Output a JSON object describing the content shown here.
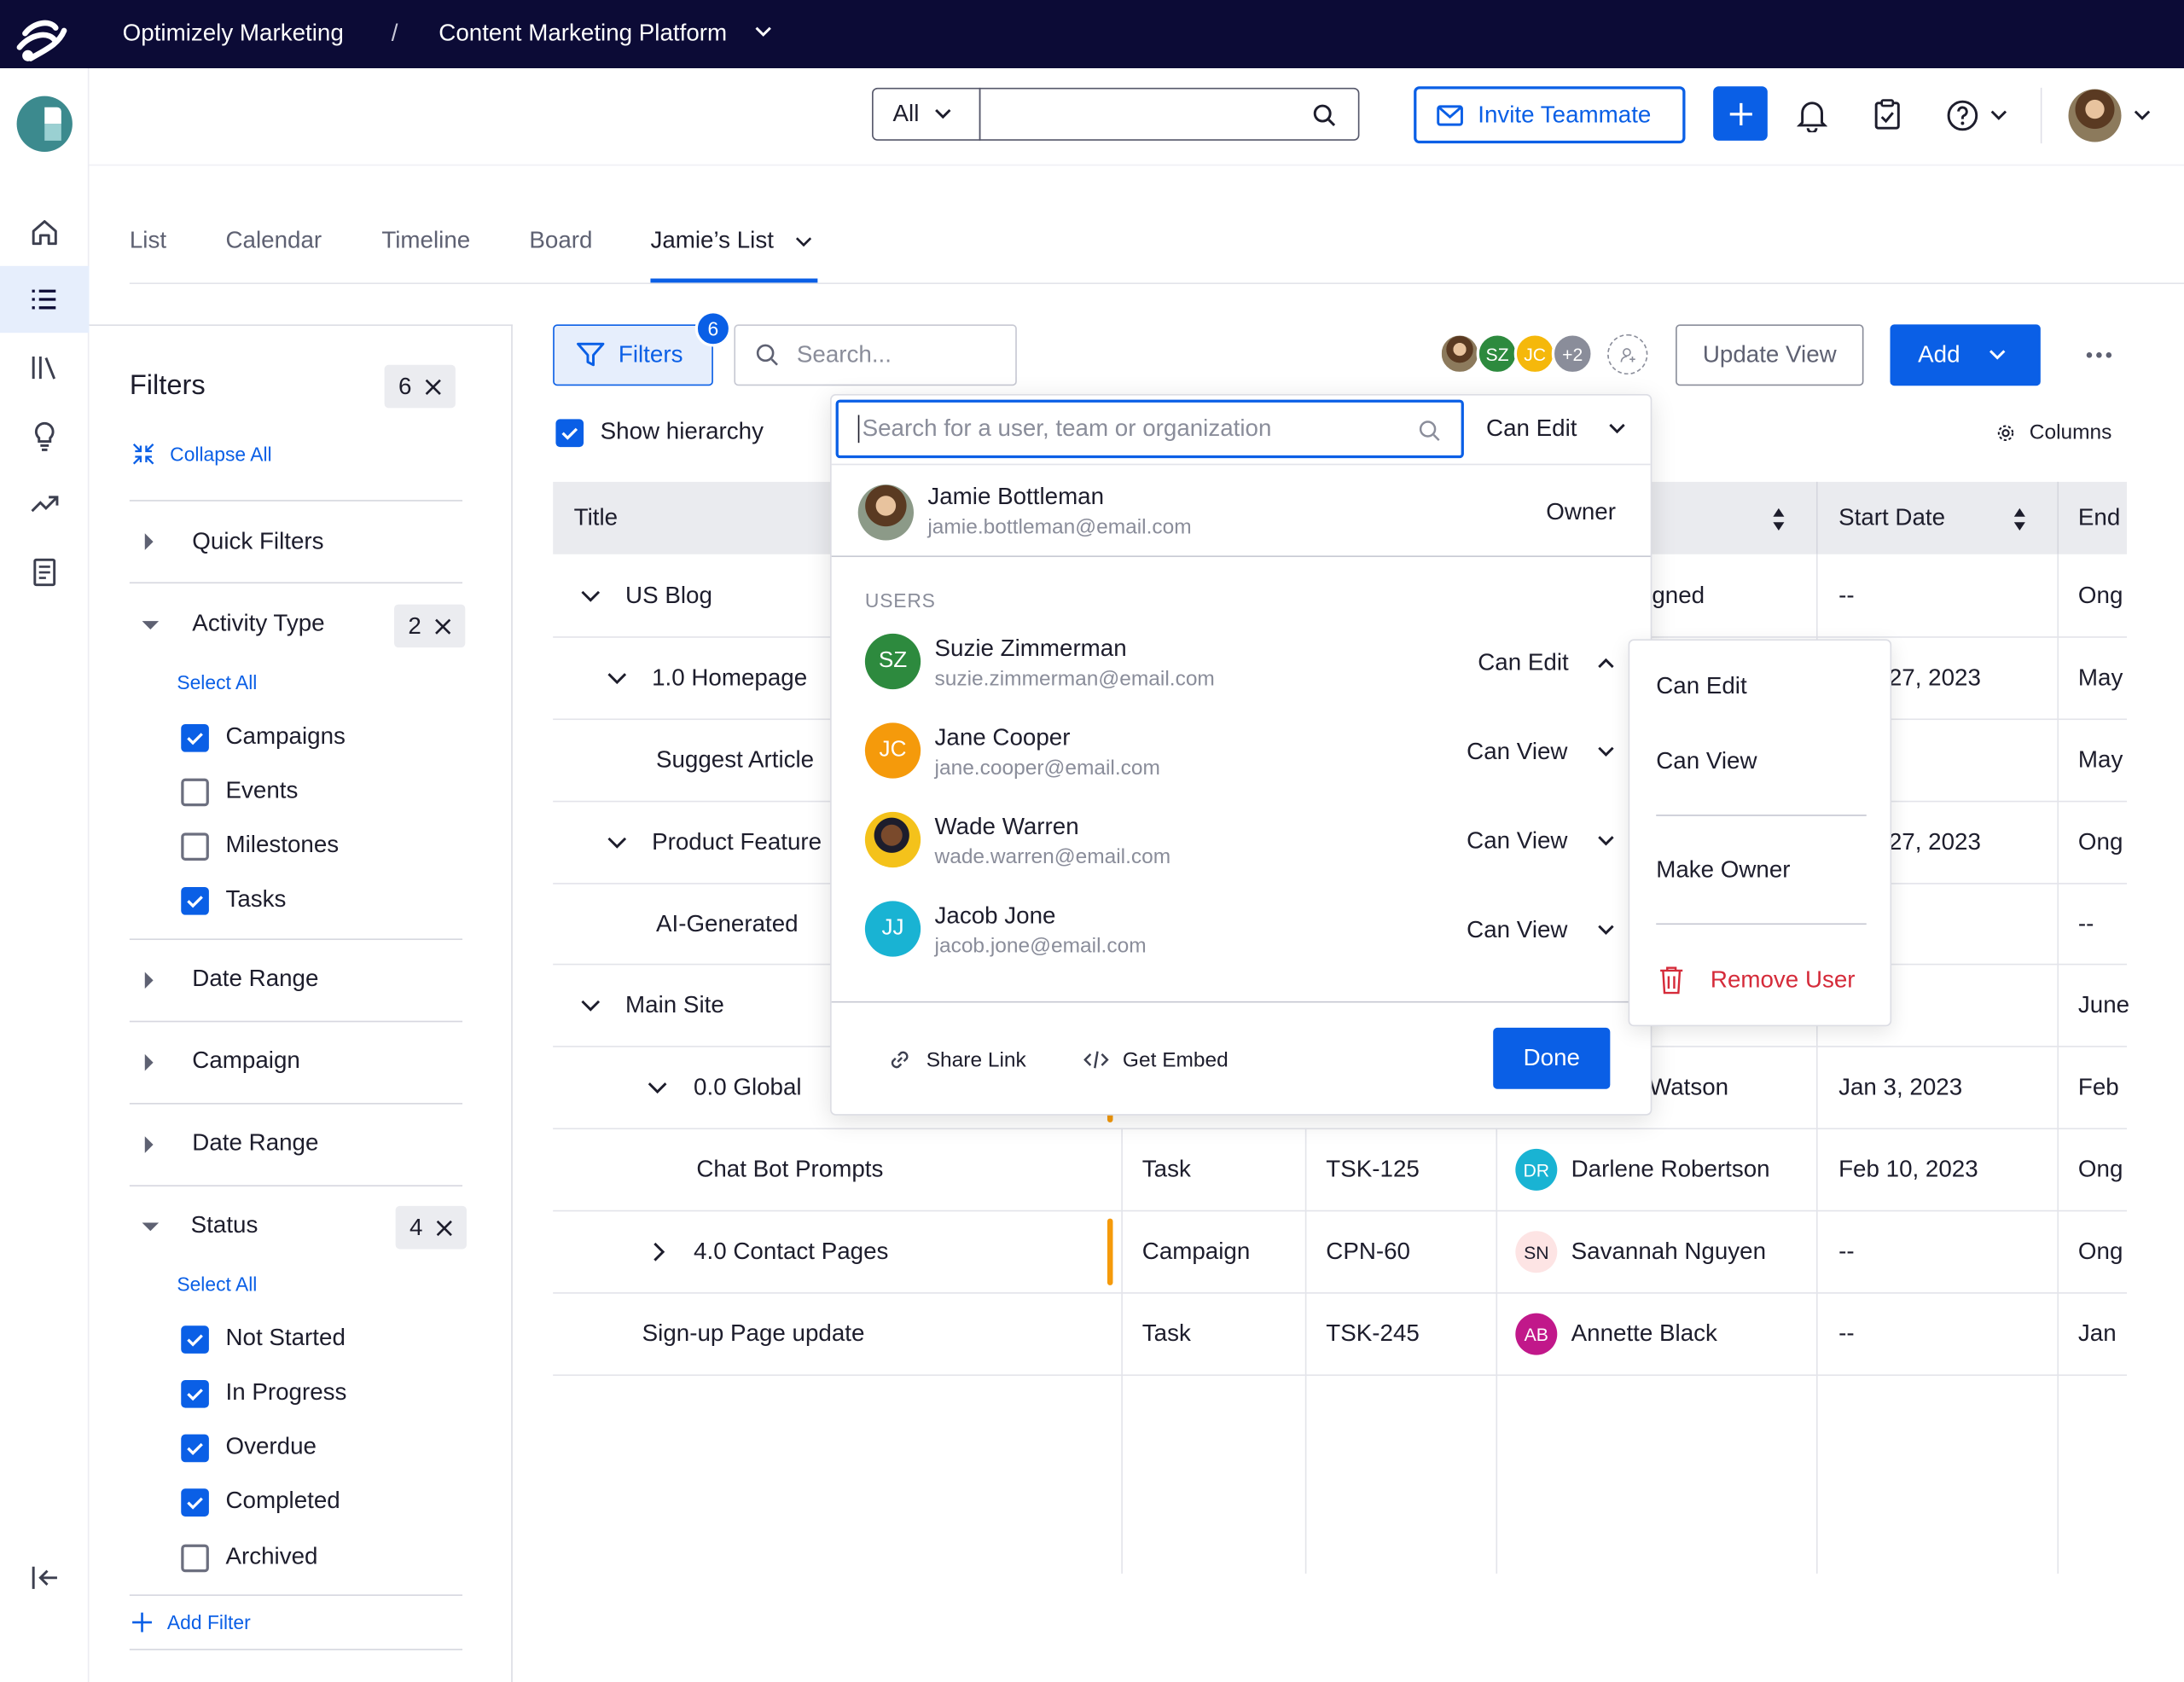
{
  "topbar": {
    "product": "Optimizely Marketing",
    "separator": "/",
    "platform": "Content Marketing Platform"
  },
  "header": {
    "search_scope": "All",
    "search_placeholder": "",
    "invite_label": "Invite Teammate"
  },
  "tabs": [
    "List",
    "Calendar",
    "Timeline",
    "Board",
    "Jamie’s List"
  ],
  "toolbar": {
    "filters_label": "Filters",
    "filters_count": "6",
    "search_placeholder": "Search...",
    "more_avatars": "+2",
    "update_view": "Update View",
    "add": "Add",
    "show_hierarchy": "Show hierarchy",
    "columns": "Columns"
  },
  "filters": {
    "title": "Filters",
    "count": "6",
    "collapse_all": "Collapse All",
    "quick_filters": "Quick Filters",
    "activity_type": {
      "label": "Activity Type",
      "count": "2",
      "select_all": "Select All",
      "options": [
        {
          "label": "Campaigns",
          "checked": true
        },
        {
          "label": "Events",
          "checked": false
        },
        {
          "label": "Milestones",
          "checked": false
        },
        {
          "label": "Tasks",
          "checked": true
        }
      ]
    },
    "date_range_1": "Date Range",
    "campaign": "Campaign",
    "date_range_2": "Date Range",
    "status": {
      "label": "Status",
      "count": "4",
      "select_all": "Select All",
      "options": [
        {
          "label": "Not Started",
          "checked": true
        },
        {
          "label": "In Progress",
          "checked": true
        },
        {
          "label": "Overdue",
          "checked": true
        },
        {
          "label": "Completed",
          "checked": true
        },
        {
          "label": "Archived",
          "checked": false
        }
      ]
    },
    "add_filter": "Add Filter"
  },
  "table": {
    "headers": {
      "title": "Title",
      "start": "Start Date",
      "end": "End"
    },
    "rows": [
      {
        "title": "US Blog",
        "c_owner": "gned",
        "start": "--",
        "end": "Ong"
      },
      {
        "title": "1.0 Homepage",
        "start": "27, 2023",
        "end": "May"
      },
      {
        "title": "Suggest Article",
        "end": "May"
      },
      {
        "title": "Product Feature",
        "start": "27, 2023",
        "end": "Ong"
      },
      {
        "title": "AI-Generated",
        "end": "--"
      },
      {
        "title": "Main Site",
        "end": "June"
      },
      {
        "title": "0.0 Global",
        "owner": "Watson",
        "start": "Jan 3, 2023",
        "end": "Feb"
      },
      {
        "title": "Chat Bot Prompts",
        "type": "Task",
        "id": "TSK-125",
        "owner_initials": "DR",
        "owner": "Darlene Robertson",
        "start": "Feb 10, 2023",
        "end": "Ong"
      },
      {
        "title": "4.0 Contact Pages",
        "type": "Campaign",
        "id": "CPN-60",
        "owner_initials": "SN",
        "owner": "Savannah Nguyen",
        "start": "--",
        "end": "Ong"
      },
      {
        "title": "Sign-up Page update",
        "type": "Task",
        "id": "TSK-245",
        "owner_initials": "AB",
        "owner": "Annette Black",
        "start": "--",
        "end": "Jan"
      }
    ]
  },
  "share": {
    "search_placeholder": "Search for a user, team or organization",
    "default_perm": "Can Edit",
    "owner": {
      "name": "Jamie Bottleman",
      "email": "jamie.bottleman@email.com",
      "role": "Owner"
    },
    "users_label": "USERS",
    "users": [
      {
        "initials": "SZ",
        "name": "Suzie Zimmerman",
        "email": "suzie.zimmerman@email.com",
        "perm": "Can Edit",
        "color": "#2d8a3e"
      },
      {
        "initials": "JC",
        "name": "Jane Cooper",
        "email": "jane.cooper@email.com",
        "perm": "Can View",
        "color": "#f59a0b"
      },
      {
        "initials": "",
        "name": "Wade Warren",
        "email": "wade.warren@email.com",
        "perm": "Can View",
        "color": "#f4c21b"
      },
      {
        "initials": "JJ",
        "name": "Jacob Jone",
        "email": "jacob.jone@email.com",
        "perm": "Can View",
        "color": "#19b3d3"
      }
    ],
    "share_link": "Share Link",
    "get_embed": "Get Embed",
    "done": "Done"
  },
  "perm_menu": {
    "can_edit": "Can Edit",
    "can_view": "Can View",
    "make_owner": "Make Owner",
    "remove_user": "Remove User"
  },
  "toolbar_avatars": [
    "",
    "SZ",
    "JC"
  ]
}
